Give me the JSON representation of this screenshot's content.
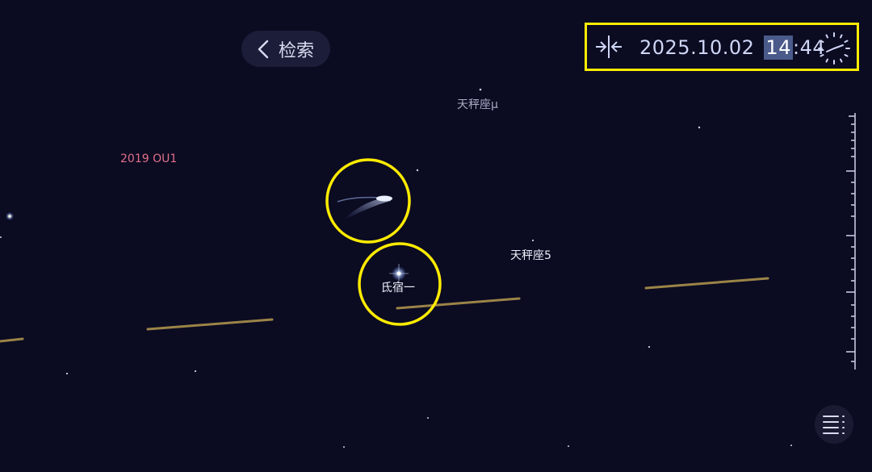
{
  "back_button": {
    "label": "检索",
    "icon": "chevron-left-icon"
  },
  "time_bar": {
    "date": "2025.10.02",
    "hour": "14",
    "minute": "44",
    "sync_icon": "time-sync-icon",
    "clock_icon": "clock-icon",
    "highlight_color": "#ffeb00"
  },
  "sky_labels": {
    "mu_lib": "天秤座μ",
    "ou1": "2019 OU1",
    "lib5": "天秤座5",
    "zubenelgenubi": "氐宿一"
  },
  "colors": {
    "background": "#0b0b22",
    "ecliptic": "#b59a4e",
    "highlight_circle": "#ffeb00",
    "asteroid_label": "#e07088"
  },
  "menu_button": {
    "icon": "list-menu-icon"
  }
}
